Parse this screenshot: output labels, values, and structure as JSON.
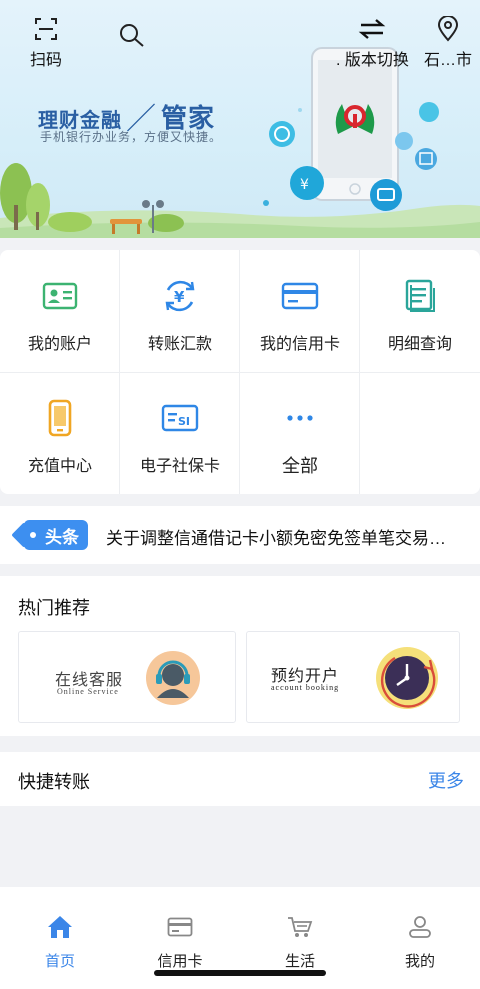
{
  "topbar": {
    "scan_label": "扫码",
    "version_label": ". 版本切换",
    "location_label": "石…市"
  },
  "banner": {
    "title_left": "理财金融",
    "title_right": "管家",
    "subtitle": "手机银行办业务，方便又快捷。"
  },
  "grid": {
    "items": [
      {
        "label": "我的账户",
        "icon": "account-card-icon"
      },
      {
        "label": "转账汇款",
        "icon": "transfer-yuan-icon"
      },
      {
        "label": "我的信用卡",
        "icon": "credit-card-icon"
      },
      {
        "label": "明细查询",
        "icon": "detail-list-icon"
      },
      {
        "label": "充值中心",
        "icon": "phone-topup-icon"
      },
      {
        "label": "电子社保卡",
        "icon": "social-security-card-icon"
      },
      {
        "label": "全部",
        "icon": "more-dots-icon"
      }
    ]
  },
  "news": {
    "tag": "头条",
    "text": "关于调整信通借记卡小额免密免签单笔交易限额的公告"
  },
  "hot": {
    "title": "热门推荐",
    "cards": [
      {
        "title": "在线客服",
        "subtitle": "Online Service",
        "icon": "customer-service-icon"
      },
      {
        "title": "预约开户",
        "subtitle": "account booking",
        "icon": "clock-icon"
      }
    ]
  },
  "quick": {
    "title": "快捷转账",
    "more": "更多"
  },
  "tabbar": {
    "active": "首页",
    "tabs": [
      {
        "label": "首页",
        "icon": "home-icon"
      },
      {
        "label": "信用卡",
        "icon": "card-icon"
      },
      {
        "label": "生活",
        "icon": "cart-icon"
      },
      {
        "label": "我的",
        "icon": "user-icon"
      }
    ]
  },
  "colors": {
    "accent": "#3b86e8",
    "news_tag": "#3d8ff0",
    "banner_title": "#2a5fa3",
    "logo_green": "#1e9a4a",
    "logo_red": "#d9262e"
  }
}
